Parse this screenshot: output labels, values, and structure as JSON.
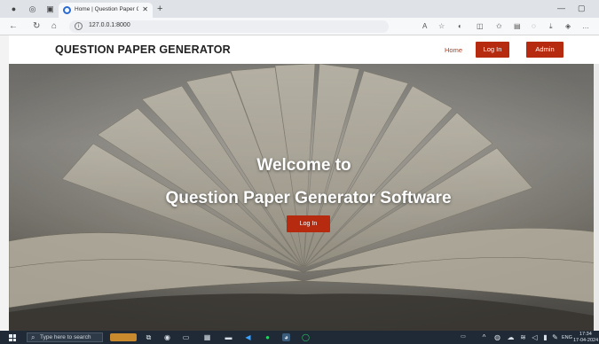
{
  "browser": {
    "tab_title": "Home | Question Paper Generat",
    "url": "127.0.0.1:8000"
  },
  "site": {
    "brand": "QUESTION PAPER GENERATOR",
    "nav": {
      "home": "Home",
      "login": "Log In",
      "admin": "Admin"
    }
  },
  "hero": {
    "title_line1": "Welcome to",
    "title_line2": "Question Paper Generator Software",
    "button": "Log In"
  },
  "taskbar": {
    "search_placeholder": "Type here to search",
    "lang": "ENG",
    "time": "17:34",
    "date": "17-04-2024"
  },
  "colors": {
    "accent": "#b62b10",
    "taskbar": "#1f2a36"
  },
  "icons": [
    "profile-icon",
    "workspaces-icon",
    "tab-actions-icon",
    "back-icon",
    "refresh-icon",
    "home-icon",
    "info-icon",
    "read-aloud-icon",
    "favorite-icon",
    "split-screen-icon",
    "favorites-icon",
    "collections-icon",
    "shield-icon",
    "download-icon",
    "copilot-icon",
    "more-icon",
    "windows-icon",
    "search-icon",
    "task-view-icon",
    "edge-icon",
    "file-explorer-icon",
    "store-icon",
    "vscode-icon",
    "spotify-icon",
    "chrome-icon",
    "whatsapp-icon"
  ]
}
